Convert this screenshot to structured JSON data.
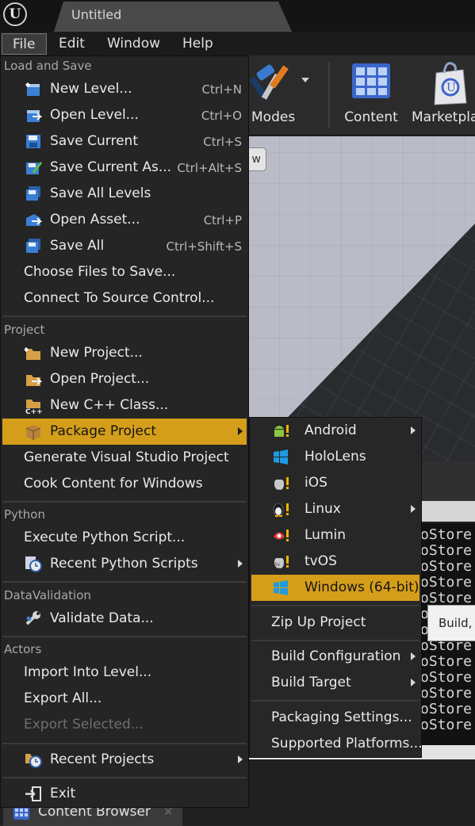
{
  "window": {
    "title": "Untitled"
  },
  "menubar": {
    "items": [
      "File",
      "Edit",
      "Window",
      "Help"
    ]
  },
  "toolbar": {
    "modes": "Modes",
    "content": "Content",
    "marketplace": "Marketplace"
  },
  "viewport": {
    "button_text": "w"
  },
  "file_menu": {
    "sections": {
      "load_save": "Load and Save",
      "project": "Project",
      "python": "Python",
      "data_validation": "DataValidation",
      "actors": "Actors"
    },
    "items": {
      "new_level": {
        "label": "New Level...",
        "shortcut": "Ctrl+N"
      },
      "open_level": {
        "label": "Open Level...",
        "shortcut": "Ctrl+O"
      },
      "save_current": {
        "label": "Save Current",
        "shortcut": "Ctrl+S"
      },
      "save_current_as": {
        "label": "Save Current As...",
        "shortcut": "Ctrl+Alt+S"
      },
      "save_all_levels": {
        "label": "Save All Levels"
      },
      "open_asset": {
        "label": "Open Asset...",
        "shortcut": "Ctrl+P"
      },
      "save_all": {
        "label": "Save All",
        "shortcut": "Ctrl+Shift+S"
      },
      "choose_files": {
        "label": "Choose Files to Save..."
      },
      "connect_source": {
        "label": "Connect To Source Control..."
      },
      "new_project": {
        "label": "New Project..."
      },
      "open_project": {
        "label": "Open Project..."
      },
      "new_cpp_class": {
        "label": "New C++ Class..."
      },
      "package_project": {
        "label": "Package Project"
      },
      "generate_vs": {
        "label": "Generate Visual Studio Project"
      },
      "cook_content": {
        "label": "Cook Content for Windows"
      },
      "execute_python": {
        "label": "Execute Python Script..."
      },
      "recent_python": {
        "label": "Recent Python Scripts"
      },
      "validate_data": {
        "label": "Validate Data..."
      },
      "import_into_level": {
        "label": "Import Into Level..."
      },
      "export_all": {
        "label": "Export All..."
      },
      "export_selected": {
        "label": "Export Selected..."
      },
      "recent_projects": {
        "label": "Recent Projects"
      },
      "exit": {
        "label": "Exit"
      }
    }
  },
  "package_submenu": {
    "platforms": {
      "android": "Android",
      "hololens": "HoloLens",
      "ios": "iOS",
      "linux": "Linux",
      "lumin": "Lumin",
      "tvos": "tvOS",
      "windows": "Windows (64-bit)"
    },
    "zip_up": "Zip Up Project",
    "build_configuration": "Build Configuration",
    "build_target": "Build Target",
    "packaging_settings": "Packaging Settings...",
    "supported_platforms": "Supported Platforms..."
  },
  "tooltip": {
    "text": "Build, c"
  },
  "output_log": {
    "lines": [
      "oStore",
      "oStore",
      "oStore",
      "oStore",
      "oStore",
      "oStore",
      "oStore",
      "oStore",
      "oStore",
      "oStore",
      "oStore",
      "oStore",
      "oStore"
    ]
  },
  "content_browser_tab": {
    "label": "Content Browser"
  },
  "colors": {
    "highlight": "#d59e1a",
    "menu_bg": "#252525"
  }
}
